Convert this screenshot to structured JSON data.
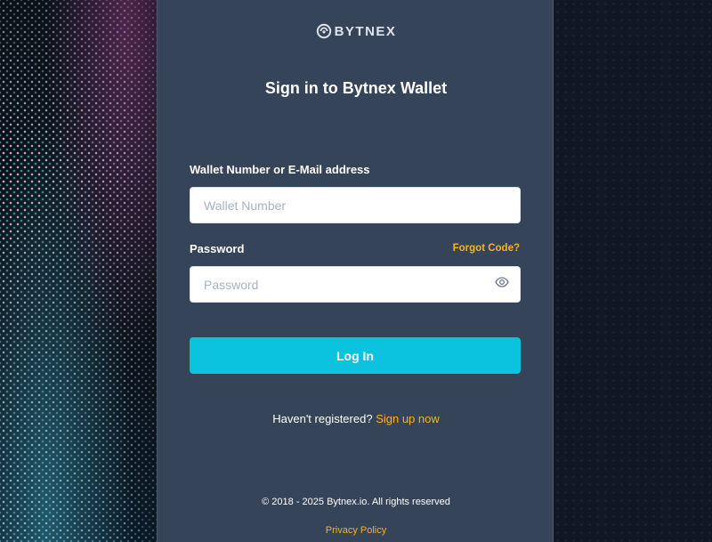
{
  "brand": {
    "logo_text": "BYTNEX",
    "logo_icon": "bytnex-logo-icon"
  },
  "form": {
    "title": "Sign in to Bytnex Wallet",
    "wallet_label": "Wallet Number or E-Mail address",
    "wallet_placeholder": "Wallet Number",
    "wallet_value": "",
    "password_label": "Password",
    "password_placeholder": "Password",
    "password_value": "",
    "forgot_label": "Forgot Code?",
    "password_toggle_icon": "eye-icon",
    "login_label": "Log In"
  },
  "register": {
    "prompt": "Haven't registered?",
    "link_label": "Sign up now"
  },
  "footer": {
    "copyright": "© 2018 - 2025 Bytnex.io. All rights reserved",
    "privacy_label": "Privacy Policy"
  },
  "colors": {
    "panel": "#364459",
    "accent": "#0bc3df",
    "link": "#f5b324",
    "background": "#141a26"
  }
}
